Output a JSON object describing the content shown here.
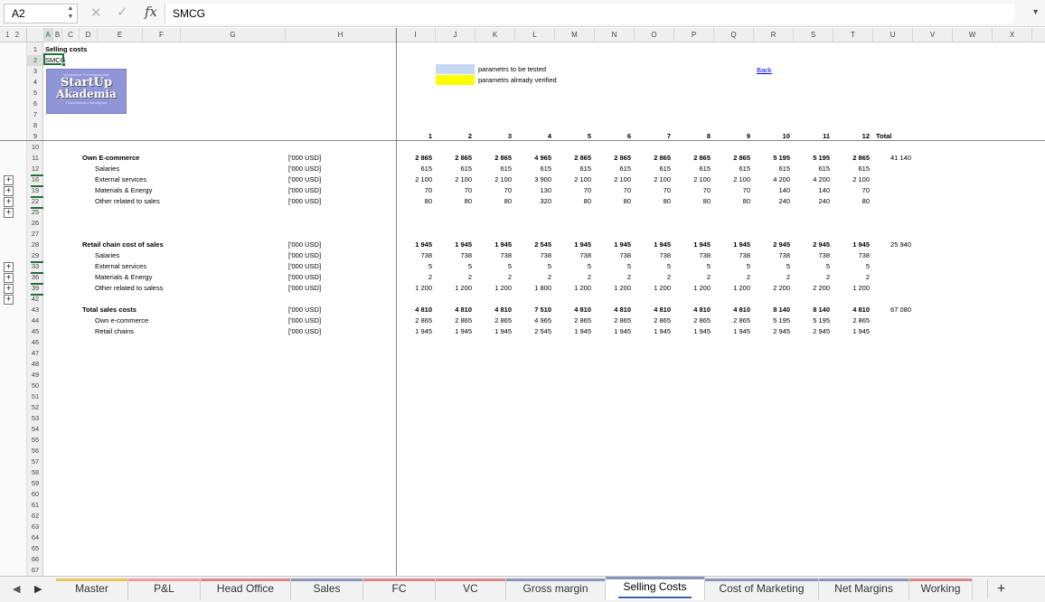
{
  "formula_bar": {
    "name_box": "A2",
    "formula": "SMCG",
    "fx_label": "fx"
  },
  "outline": {
    "levels": "1 2"
  },
  "columns": [
    "A",
    "B",
    "C",
    "D",
    "E",
    "F",
    "G",
    "H",
    "I",
    "J",
    "K",
    "L",
    "M",
    "N",
    "O",
    "P",
    "Q",
    "R",
    "S",
    "T",
    "U",
    "V",
    "W",
    "X"
  ],
  "row_numbers": [
    "1",
    "2",
    "3",
    "4",
    "5",
    "6",
    "7",
    "8",
    "9",
    "10",
    "11",
    "12",
    "16",
    "19",
    "22",
    "25",
    "26",
    "27",
    "28",
    "29",
    "33",
    "36",
    "39",
    "42",
    "43",
    "44",
    "45",
    "46",
    "47",
    "48",
    "49",
    "50",
    "51",
    "52",
    "53",
    "54",
    "55",
    "56",
    "57",
    "58",
    "59",
    "60",
    "61",
    "62",
    "63",
    "64",
    "65",
    "66",
    "67"
  ],
  "header": {
    "title": "Selling costs",
    "code": "SMCG"
  },
  "logo": {
    "top": "Wszystkich Przedsiębiorców",
    "line1": "StartUp",
    "line2": "Akademia",
    "bottom": "Powodzenia z startupami"
  },
  "legend": [
    {
      "color": "#c5d9f1",
      "text": "parametrs to be tested"
    },
    {
      "color": "#ffff00",
      "text": "parametrs already verified"
    }
  ],
  "back_link": "Back",
  "months": [
    "1",
    "2",
    "3",
    "4",
    "5",
    "6",
    "7",
    "8",
    "9",
    "10",
    "11",
    "12"
  ],
  "total_label": "Total",
  "unit": "['000 USD]",
  "rows": [
    {
      "label": "Own E-commerce",
      "bold": true,
      "indent": false,
      "values": [
        "2 865",
        "2 865",
        "2 865",
        "4 965",
        "2 865",
        "2 865",
        "2 865",
        "2 865",
        "2 865",
        "5 195",
        "5 195",
        "2 865"
      ],
      "total": "41 140"
    },
    {
      "label": "Salaries",
      "bold": false,
      "indent": true,
      "values": [
        "615",
        "615",
        "615",
        "615",
        "615",
        "615",
        "615",
        "615",
        "615",
        "615",
        "615",
        "615"
      ],
      "total": ""
    },
    {
      "label": "External services",
      "bold": false,
      "indent": true,
      "values": [
        "2 100",
        "2 100",
        "2 100",
        "3 900",
        "2 100",
        "2 100",
        "2 100",
        "2 100",
        "2 100",
        "4 200",
        "4 200",
        "2 100"
      ],
      "total": ""
    },
    {
      "label": "Materials & Energy",
      "bold": false,
      "indent": true,
      "values": [
        "70",
        "70",
        "70",
        "130",
        "70",
        "70",
        "70",
        "70",
        "70",
        "140",
        "140",
        "70"
      ],
      "total": ""
    },
    {
      "label": "Other related to sales",
      "bold": false,
      "indent": true,
      "values": [
        "80",
        "80",
        "80",
        "320",
        "80",
        "80",
        "80",
        "80",
        "80",
        "240",
        "240",
        "80"
      ],
      "total": ""
    },
    {
      "label": "Retail chain cost of sales",
      "bold": true,
      "indent": false,
      "values": [
        "1 945",
        "1 945",
        "1 945",
        "2 545",
        "1 945",
        "1 945",
        "1 945",
        "1 945",
        "1 945",
        "2 945",
        "2 945",
        "1 945"
      ],
      "total": "25 940"
    },
    {
      "label": "Salaries",
      "bold": false,
      "indent": true,
      "values": [
        "738",
        "738",
        "738",
        "738",
        "738",
        "738",
        "738",
        "738",
        "738",
        "738",
        "738",
        "738"
      ],
      "total": ""
    },
    {
      "label": "External services",
      "bold": false,
      "indent": true,
      "values": [
        "5",
        "5",
        "5",
        "5",
        "5",
        "5",
        "5",
        "5",
        "5",
        "5",
        "5",
        "5"
      ],
      "total": ""
    },
    {
      "label": "Materials & Energy",
      "bold": false,
      "indent": true,
      "values": [
        "2",
        "2",
        "2",
        "2",
        "2",
        "2",
        "2",
        "2",
        "2",
        "2",
        "2",
        "2"
      ],
      "total": ""
    },
    {
      "label": "Other related to saless",
      "bold": false,
      "indent": true,
      "values": [
        "1 200",
        "1 200",
        "1 200",
        "1 800",
        "1 200",
        "1 200",
        "1 200",
        "1 200",
        "1 200",
        "2 200",
        "2 200",
        "1 200"
      ],
      "total": ""
    },
    {
      "label": "Total sales costs",
      "bold": true,
      "indent": false,
      "values": [
        "4 810",
        "4 810",
        "4 810",
        "7 510",
        "4 810",
        "4 810",
        "4 810",
        "4 810",
        "4 810",
        "8 140",
        "8 140",
        "4 810"
      ],
      "total": "67 080"
    },
    {
      "label": "Own e-commerce",
      "bold": false,
      "indent": true,
      "values": [
        "2 865",
        "2 865",
        "2 865",
        "4 965",
        "2 865",
        "2 865",
        "2 865",
        "2 865",
        "2 865",
        "5 195",
        "5 195",
        "2 865"
      ],
      "total": ""
    },
    {
      "label": "Retail chains",
      "bold": false,
      "indent": true,
      "values": [
        "1 945",
        "1 945",
        "1 945",
        "2 545",
        "1 945",
        "1 945",
        "1 945",
        "1 945",
        "1 945",
        "2 945",
        "2 945",
        "1 945"
      ],
      "total": ""
    }
  ],
  "tabs": [
    {
      "label": "Master",
      "color": "#e8c75a"
    },
    {
      "label": "P&L",
      "color": "#e8a0a0"
    },
    {
      "label": "Head Office",
      "color": "#d88888"
    },
    {
      "label": "Sales",
      "color": "#8a96b8"
    },
    {
      "label": "FC",
      "color": "#d88888"
    },
    {
      "label": "VC",
      "color": "#d88888"
    },
    {
      "label": "Gross margin",
      "color": "#8a96b8"
    },
    {
      "label": "Selling Costs",
      "color": "#8a96b8"
    },
    {
      "label": "Cost of Marketing",
      "color": "#8a96b8"
    },
    {
      "label": "Net Margins",
      "color": "#8a96b8"
    },
    {
      "label": "Working",
      "color": "#d88888"
    }
  ],
  "active_tab": "Selling Costs"
}
